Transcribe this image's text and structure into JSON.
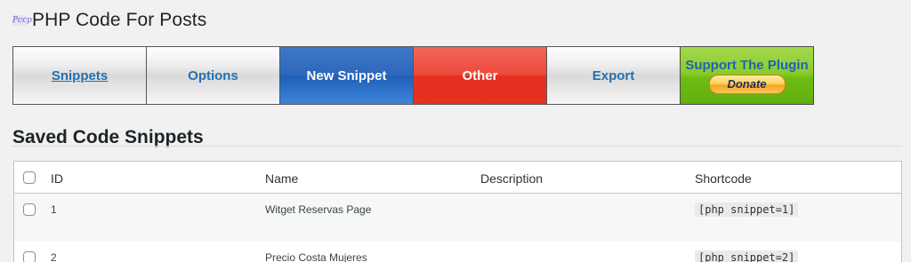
{
  "header": {
    "logo_icon": "plugin-logo-icon",
    "logo_text": "Pccp",
    "title": "PHP Code For Posts"
  },
  "tabs": [
    {
      "label": "Snippets",
      "state": "current"
    },
    {
      "label": "Options"
    },
    {
      "label": "New Snippet",
      "color": "#2a6fc9"
    },
    {
      "label": "Other",
      "color": "#e8392b"
    }
  ],
  "tab_export": {
    "label": "Export"
  },
  "support": {
    "label": "Support The Plugin",
    "donate_label": "Donate",
    "color": "#7cc31f"
  },
  "section_title": "Saved Code Snippets",
  "table": {
    "checkbox_icon": "checkbox-icon",
    "columns": {
      "id": "ID",
      "name": "Name",
      "description": "Description",
      "shortcode": "Shortcode"
    },
    "rows": [
      {
        "id": "1",
        "name": "Witget Reservas Page",
        "description": "",
        "shortcode": "[php snippet=1]"
      },
      {
        "id": "2",
        "name": "Precio Costa Mujeres",
        "description": "",
        "shortcode": "[php snippet=2]"
      }
    ]
  }
}
